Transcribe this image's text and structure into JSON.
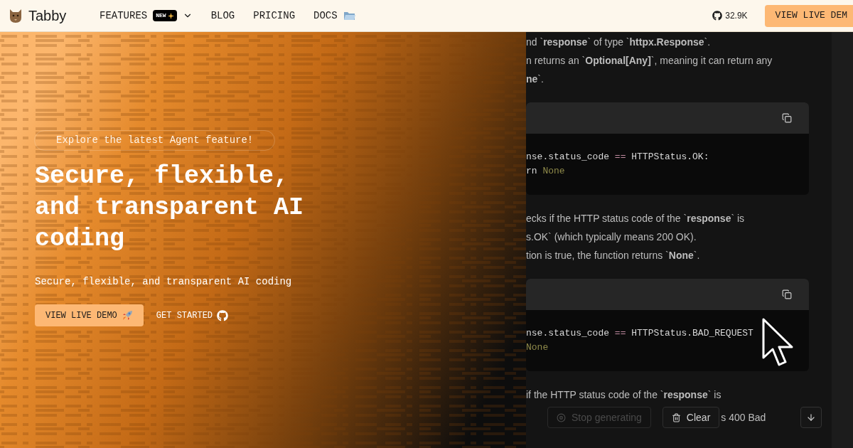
{
  "header": {
    "brand": "Tabby",
    "nav": [
      {
        "label": "FEATURES",
        "badge": "NEW",
        "kind": "dropdown"
      },
      {
        "label": "BLOG",
        "kind": "plain"
      },
      {
        "label": "PRICING",
        "kind": "plain"
      },
      {
        "label": "DOCS",
        "kind": "folder"
      }
    ],
    "stars": "32.9K",
    "cta": "VIEW LIVE DEM"
  },
  "hero": {
    "announcement": "Explore the latest Agent feature!",
    "title": "Secure, flexible, and transparent AI coding",
    "subtitle": "Secure, flexible, and transparent AI coding",
    "primary_button": "VIEW LIVE DEMO",
    "secondary_button": "GET STARTED"
  },
  "chat": {
    "blocks": [
      {
        "kind": "text",
        "lines": [
          "nd `**response**` of type `**httpx.Response**`.",
          "n returns an `**Optional[Any]**`, meaning it can return any",
          "**ne**`."
        ]
      },
      {
        "kind": "code",
        "lines": [
          [
            {
              "text": "nse.status_code ",
              "kind": "plain"
            },
            {
              "text": "==",
              "kind": "operator"
            },
            {
              "text": " HTTPStatus.OK:",
              "kind": "plain"
            }
          ],
          [
            {
              "text": "rn ",
              "kind": "plain"
            },
            {
              "text": "None",
              "kind": "keyword"
            }
          ]
        ]
      },
      {
        "kind": "text",
        "lines": [
          "ecks if the HTTP status code of the `**response**` is",
          "s.OK` (which typically means 200 OK).",
          "tion is true, the function returns `**None**`."
        ]
      },
      {
        "kind": "code",
        "lines": [
          [
            {
              "text": "nse.status_code ",
              "kind": "plain"
            },
            {
              "text": "==",
              "kind": "operator"
            },
            {
              "text": " HTTPStatus.BAD_REQUEST",
              "kind": "plain"
            }
          ],
          [
            {
              "text": "None",
              "kind": "keyword"
            }
          ]
        ]
      },
      {
        "kind": "text",
        "lines": [
          "if the HTTP status code of the `**response**` is"
        ]
      }
    ],
    "trailing_text": "s 400 Bad",
    "stop_button": "Stop generating",
    "clear_button": "Clear"
  }
}
